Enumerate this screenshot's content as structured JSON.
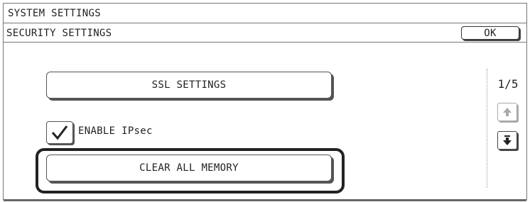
{
  "header": {
    "title": "SYSTEM SETTINGS"
  },
  "subheader": {
    "title": "SECURITY SETTINGS",
    "ok_label": "OK"
  },
  "main": {
    "ssl_button_label": "SSL SETTINGS",
    "ipsec_checkbox": {
      "label": "ENABLE IPsec",
      "checked": true
    },
    "clear_memory_button_label": "CLEAR ALL MEMORY"
  },
  "pager": {
    "page_indicator": "1/5",
    "up_icon": "arrow-up-icon",
    "down_icon": "arrow-down-icon"
  },
  "colors": {
    "border": "#555555",
    "disabled": "#aaaaaa",
    "highlight": "#222222"
  }
}
